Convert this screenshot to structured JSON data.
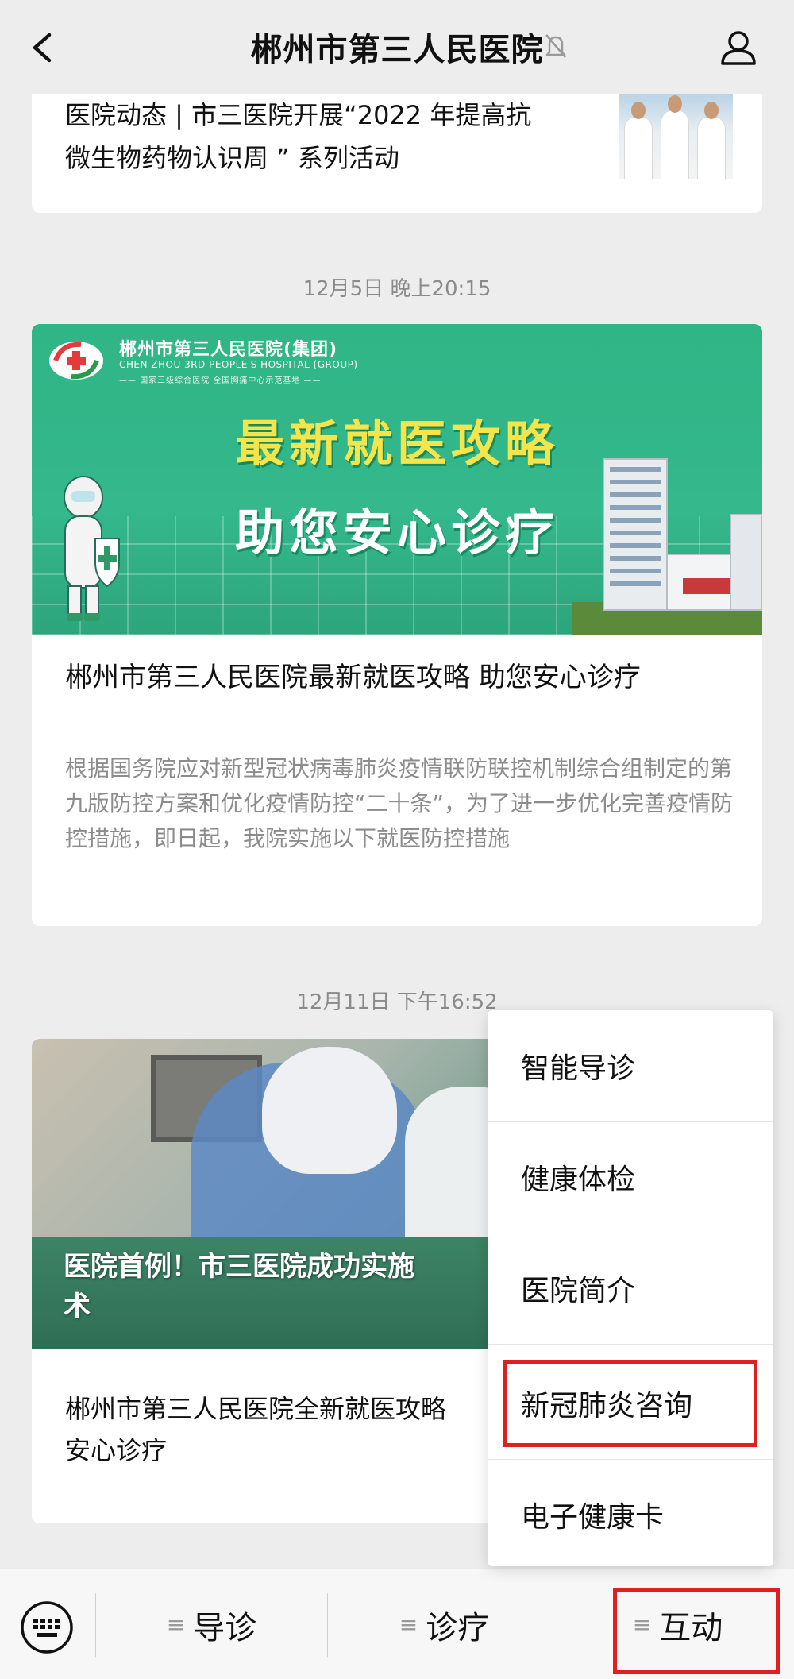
{
  "header": {
    "title": "郴州市第三人民医院",
    "back_icon": "chevron-left-icon",
    "mute_icon": "bell-off-icon",
    "user_icon": "user-icon"
  },
  "messages": [
    {
      "title_lines": [
        "医院动态 | 市三医院开展“2022 年提高抗",
        "微生物药物认识周 ” 系列活动"
      ]
    },
    {
      "timestamp": "12月5日 晚上20:15",
      "banner": {
        "logo_cn": "郴州市第三人民医院(集团)",
        "logo_en": "CHEN ZHOU 3RD PEOPLE'S HOSPITAL (GROUP)",
        "logo_sub": "—— 国家三级综合医院  全国胸痛中心示范基地 ——",
        "headline_1": "最新就医攻略",
        "headline_2": "助您安心诊疗"
      },
      "title": "郴州市第三人民医院最新就医攻略 助您安心诊疗",
      "desc": "根据国务院应对新型冠状病毒肺炎疫情联防联控机制综合组制定的第九版防控方案和优化疫情防控“二十条”，为了进一步优化完善疫情防控措施，即日起，我院实施以下就医防控措施"
    },
    {
      "timestamp": "12月11日 下午16:52",
      "photo_caption": "医院首例！市三医院成功实施",
      "photo_caption_line2": "术",
      "item_title": "郴州市第三人民医院全新就医攻略",
      "item_title_line2": "安心诊疗"
    }
  ],
  "popup_menu": {
    "items": [
      "智能导诊",
      "健康体检",
      "医院简介",
      "新冠肺炎咨询",
      "电子健康卡"
    ],
    "highlighted_index": 3
  },
  "bottom_bar": {
    "keyboard_icon": "keyboard-icon",
    "tabs": [
      {
        "label": "导诊",
        "icon": "menu-icon"
      },
      {
        "label": "诊疗",
        "icon": "menu-icon"
      },
      {
        "label": "互动",
        "icon": "menu-icon"
      }
    ],
    "highlighted_tab": 2
  },
  "colors": {
    "background": "#ededed",
    "banner_green": "#34b88c",
    "headline_yellow": "#f6e54a",
    "highlight_red": "#e02020",
    "muted_text": "#8c8c8c"
  }
}
